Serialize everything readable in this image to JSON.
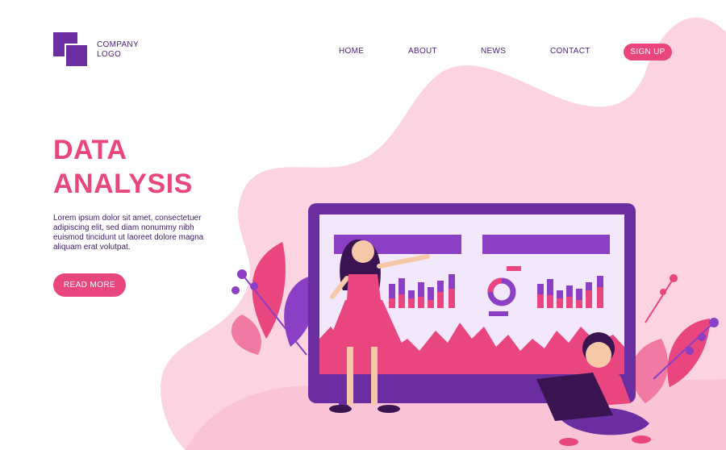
{
  "logo": {
    "line1": "COMPANY",
    "line2": "LOGO"
  },
  "nav": {
    "items": [
      {
        "label": "HOME"
      },
      {
        "label": "ABOUT"
      },
      {
        "label": "NEWS"
      },
      {
        "label": "CONTACT"
      }
    ],
    "signup_label": "SIGN UP"
  },
  "hero": {
    "title_line1": "DATA",
    "title_line2": "ANALYSIS",
    "body": "Lorem ipsum dolor sit amet, consectetuer adipiscing elit, sed diam nonummy nibh euismod tincidunt ut laoreet dolore magna aliquam erat volutpat.",
    "cta_label": "READ MORE"
  },
  "colors": {
    "accent": "#e9457e",
    "purple": "#6a2ea0",
    "blob": "#fbd3e1",
    "panel": "#f3e8fb"
  },
  "icons": [
    "company-logo-icon",
    "bar-chart-icon",
    "donut-chart-icon",
    "plant-icon"
  ]
}
